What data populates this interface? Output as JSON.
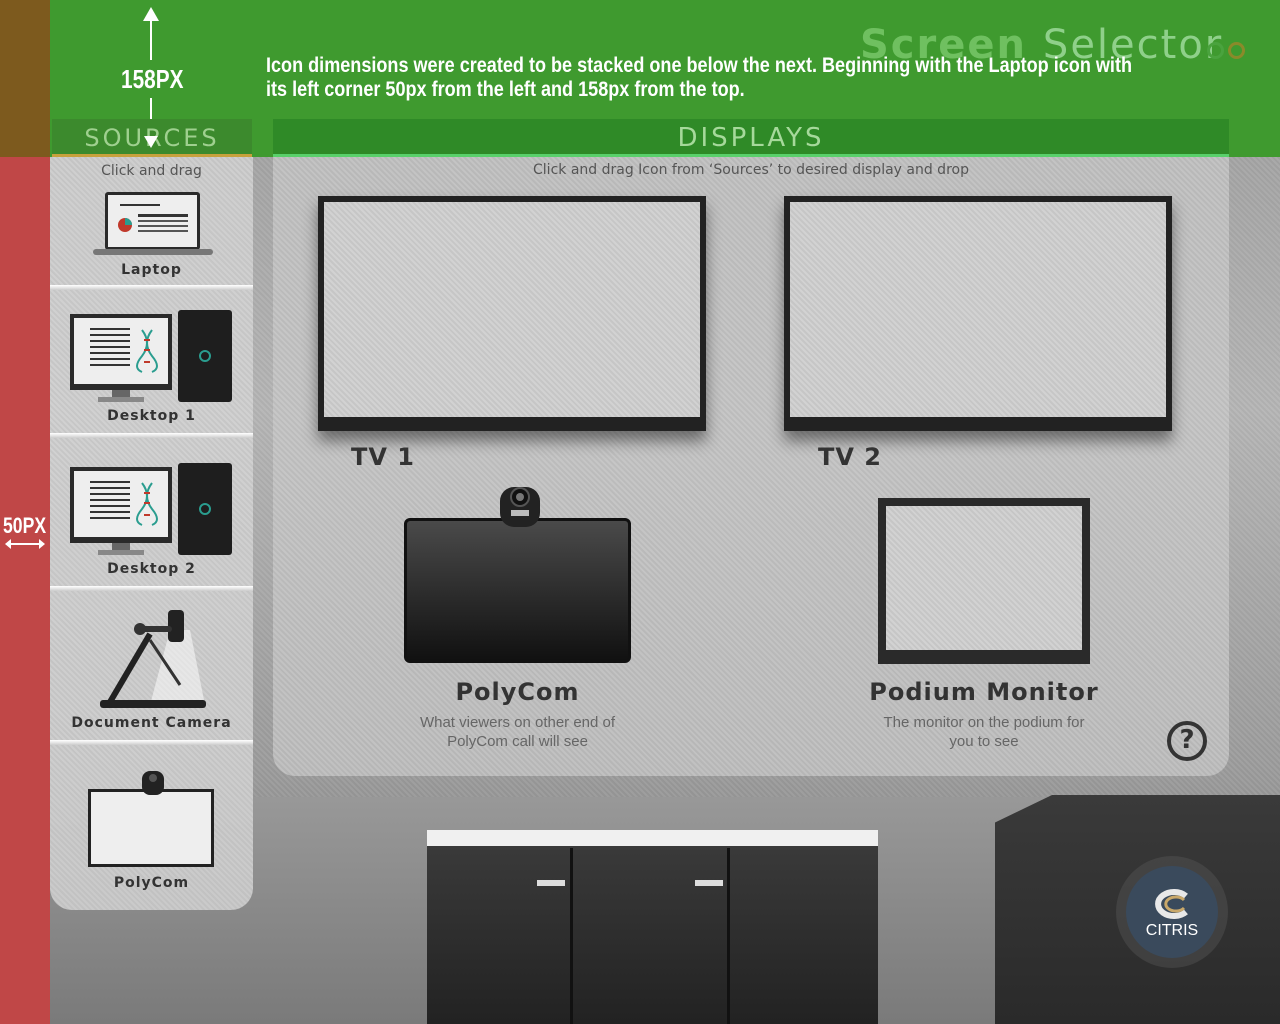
{
  "app": {
    "title_word1": "Screen",
    "title_word2": "Selector"
  },
  "annotation": {
    "top_px": "158PX",
    "left_px": "50PX",
    "note_line1": "Icon dimensions were created to be stacked one below the next. Beginning with the Laptop icon with",
    "note_line2": "its left corner 50px from the left and 158px from the top."
  },
  "sources": {
    "heading": "SOURCES",
    "hint": "Click and drag",
    "items": [
      {
        "label": "Laptop",
        "icon": "laptop-icon"
      },
      {
        "label": "Desktop 1",
        "icon": "desktop-icon"
      },
      {
        "label": "Desktop 2",
        "icon": "desktop-icon"
      },
      {
        "label": "Document Camera",
        "icon": "document-camera-icon"
      },
      {
        "label": "PolyCom",
        "icon": "polycom-icon"
      }
    ]
  },
  "displays": {
    "heading": "DISPLAYS",
    "hint": "Click and drag Icon from ‘Sources’ to desired display and drop",
    "tv1": "TV 1",
    "tv2": "TV 2",
    "polycom": {
      "title": "PolyCom",
      "desc_line1": "What viewers on other end of",
      "desc_line2": "PolyCom call will see"
    },
    "podium": {
      "title": "Podium Monitor",
      "desc_line1": "The monitor on the podium for",
      "desc_line2": "you to see"
    },
    "help": "?"
  },
  "logo": {
    "text": "CITRIS"
  },
  "colors": {
    "accent_green": "#3f9a2f",
    "left_strip": "#c04747"
  }
}
